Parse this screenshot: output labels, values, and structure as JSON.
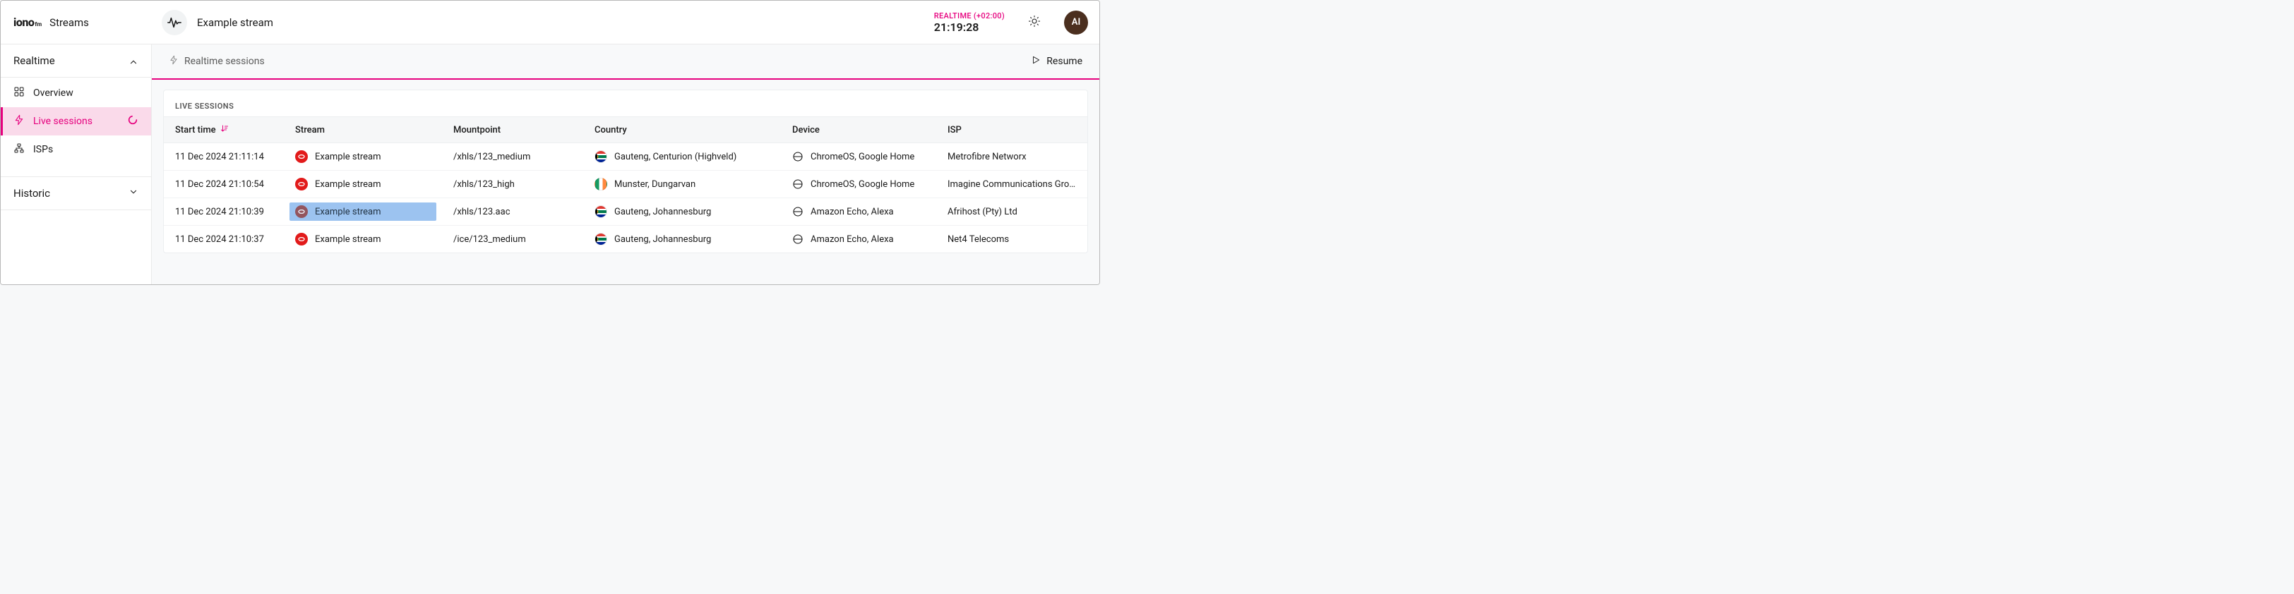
{
  "brand": {
    "name": "iono",
    "suffix": "fm",
    "section": "Streams"
  },
  "stream_context": {
    "name": "Example stream"
  },
  "header": {
    "realtime_label": "REALTIME (+02:00)",
    "realtime_time": "21:19:28",
    "avatar_initials": "AI"
  },
  "sidebar": {
    "group_realtime": "Realtime",
    "group_historic": "Historic",
    "items": {
      "overview": "Overview",
      "live_sessions": "Live sessions",
      "isps": "ISPs"
    }
  },
  "toolbar": {
    "tab_label": "Realtime sessions",
    "resume_label": "Resume"
  },
  "table": {
    "title": "LIVE SESSIONS",
    "headers": {
      "start_time": "Start time",
      "stream": "Stream",
      "mountpoint": "Mountpoint",
      "country": "Country",
      "device": "Device",
      "isp": "ISP"
    },
    "rows": [
      {
        "start_time": "11 Dec 2024 21:11:14",
        "stream": "Example stream",
        "mountpoint": "/xhls/123_medium",
        "country_flag": "za",
        "country": "Gauteng, Centurion (Highveld)",
        "device": "ChromeOS, Google Home",
        "isp": "Metrofibre Networx",
        "selected": false
      },
      {
        "start_time": "11 Dec 2024 21:10:54",
        "stream": "Example stream",
        "mountpoint": "/xhls/123_high",
        "country_flag": "ie",
        "country": "Munster, Dungarvan",
        "device": "ChromeOS, Google Home",
        "isp": "Imagine Communications Group Li…",
        "selected": false
      },
      {
        "start_time": "11 Dec 2024 21:10:39",
        "stream": "Example stream",
        "mountpoint": "/xhls/123.aac",
        "country_flag": "za",
        "country": "Gauteng, Johannesburg",
        "device": "Amazon Echo, Alexa",
        "isp": "Afrihost (Pty) Ltd",
        "selected": true
      },
      {
        "start_time": "11 Dec 2024 21:10:37",
        "stream": "Example stream",
        "mountpoint": "/ice/123_medium",
        "country_flag": "za",
        "country": "Gauteng, Johannesburg",
        "device": "Amazon Echo, Alexa",
        "isp": "Net4 Telecoms",
        "selected": false
      }
    ]
  }
}
